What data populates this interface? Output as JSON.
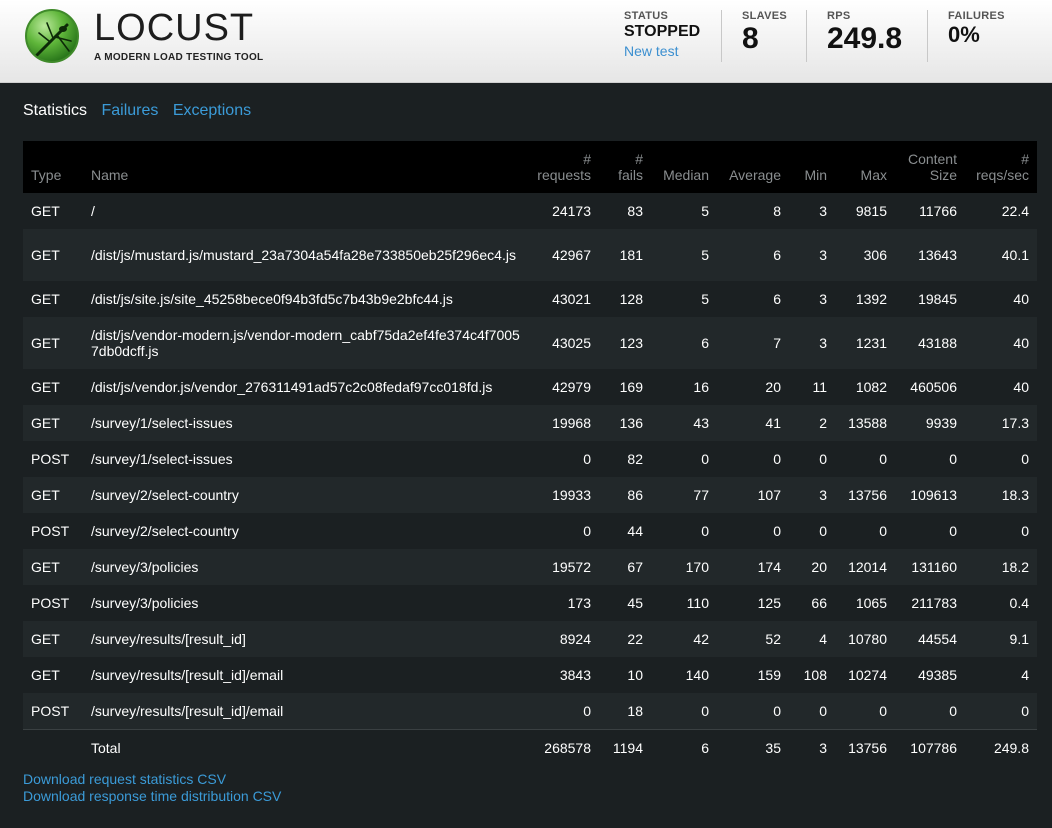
{
  "brand": {
    "name": "LOCUST",
    "tagline": "A MODERN LOAD TESTING TOOL"
  },
  "stats": {
    "status_label": "STATUS",
    "status_value": "STOPPED",
    "new_test": "New test",
    "slaves_label": "SLAVES",
    "slaves_value": "8",
    "rps_label": "RPS",
    "rps_value": "249.8",
    "failures_label": "FAILURES",
    "failures_value": "0%"
  },
  "tabs": [
    "Statistics",
    "Failures",
    "Exceptions"
  ],
  "table": {
    "headers": {
      "type": "Type",
      "name": "Name",
      "requests_a": "#",
      "requests_b": "requests",
      "fails_a": "#",
      "fails_b": "fails",
      "median": "Median",
      "average": "Average",
      "min": "Min",
      "max": "Max",
      "size_a": "Content",
      "size_b": "Size",
      "rps_a": "#",
      "rps_b": "reqs/sec"
    },
    "rows": [
      {
        "type": "GET",
        "name": "/",
        "requests": "24173",
        "fails": "83",
        "median": "5",
        "average": "8",
        "min": "3",
        "max": "9815",
        "size": "11766",
        "rps": "22.4"
      },
      {
        "type": "GET",
        "name": "/dist/js/mustard.js/mustard_23a7304a54fa28e733850eb25f296ec4.js",
        "requests": "42967",
        "fails": "181",
        "median": "5",
        "average": "6",
        "min": "3",
        "max": "306",
        "size": "13643",
        "rps": "40.1"
      },
      {
        "type": "GET",
        "name": "/dist/js/site.js/site_45258bece0f94b3fd5c7b43b9e2bfc44.js",
        "requests": "43021",
        "fails": "128",
        "median": "5",
        "average": "6",
        "min": "3",
        "max": "1392",
        "size": "19845",
        "rps": "40"
      },
      {
        "type": "GET",
        "name": "/dist/js/vendor-modern.js/vendor-modern_cabf75da2ef4fe374c4f70057db0dcff.js",
        "requests": "43025",
        "fails": "123",
        "median": "6",
        "average": "7",
        "min": "3",
        "max": "1231",
        "size": "43188",
        "rps": "40"
      },
      {
        "type": "GET",
        "name": "/dist/js/vendor.js/vendor_276311491ad57c2c08fedaf97cc018fd.js",
        "requests": "42979",
        "fails": "169",
        "median": "16",
        "average": "20",
        "min": "11",
        "max": "1082",
        "size": "460506",
        "rps": "40"
      },
      {
        "type": "GET",
        "name": "/survey/1/select-issues",
        "requests": "19968",
        "fails": "136",
        "median": "43",
        "average": "41",
        "min": "2",
        "max": "13588",
        "size": "9939",
        "rps": "17.3"
      },
      {
        "type": "POST",
        "name": "/survey/1/select-issues",
        "requests": "0",
        "fails": "82",
        "median": "0",
        "average": "0",
        "min": "0",
        "max": "0",
        "size": "0",
        "rps": "0"
      },
      {
        "type": "GET",
        "name": "/survey/2/select-country",
        "requests": "19933",
        "fails": "86",
        "median": "77",
        "average": "107",
        "min": "3",
        "max": "13756",
        "size": "109613",
        "rps": "18.3"
      },
      {
        "type": "POST",
        "name": "/survey/2/select-country",
        "requests": "0",
        "fails": "44",
        "median": "0",
        "average": "0",
        "min": "0",
        "max": "0",
        "size": "0",
        "rps": "0"
      },
      {
        "type": "GET",
        "name": "/survey/3/policies",
        "requests": "19572",
        "fails": "67",
        "median": "170",
        "average": "174",
        "min": "20",
        "max": "12014",
        "size": "131160",
        "rps": "18.2"
      },
      {
        "type": "POST",
        "name": "/survey/3/policies",
        "requests": "173",
        "fails": "45",
        "median": "110",
        "average": "125",
        "min": "66",
        "max": "1065",
        "size": "211783",
        "rps": "0.4"
      },
      {
        "type": "GET",
        "name": "/survey/results/[result_id]",
        "requests": "8924",
        "fails": "22",
        "median": "42",
        "average": "52",
        "min": "4",
        "max": "10780",
        "size": "44554",
        "rps": "9.1"
      },
      {
        "type": "GET",
        "name": "/survey/results/[result_id]/email",
        "requests": "3843",
        "fails": "10",
        "median": "140",
        "average": "159",
        "min": "108",
        "max": "10274",
        "size": "49385",
        "rps": "4"
      },
      {
        "type": "POST",
        "name": "/survey/results/[result_id]/email",
        "requests": "0",
        "fails": "18",
        "median": "0",
        "average": "0",
        "min": "0",
        "max": "0",
        "size": "0",
        "rps": "0"
      }
    ],
    "total": {
      "type": "",
      "name": "Total",
      "requests": "268578",
      "fails": "1194",
      "median": "6",
      "average": "35",
      "min": "3",
      "max": "13756",
      "size": "107786",
      "rps": "249.8"
    }
  },
  "downloads": {
    "request_stats": "Download request statistics CSV",
    "response_dist": "Download response time distribution CSV"
  }
}
